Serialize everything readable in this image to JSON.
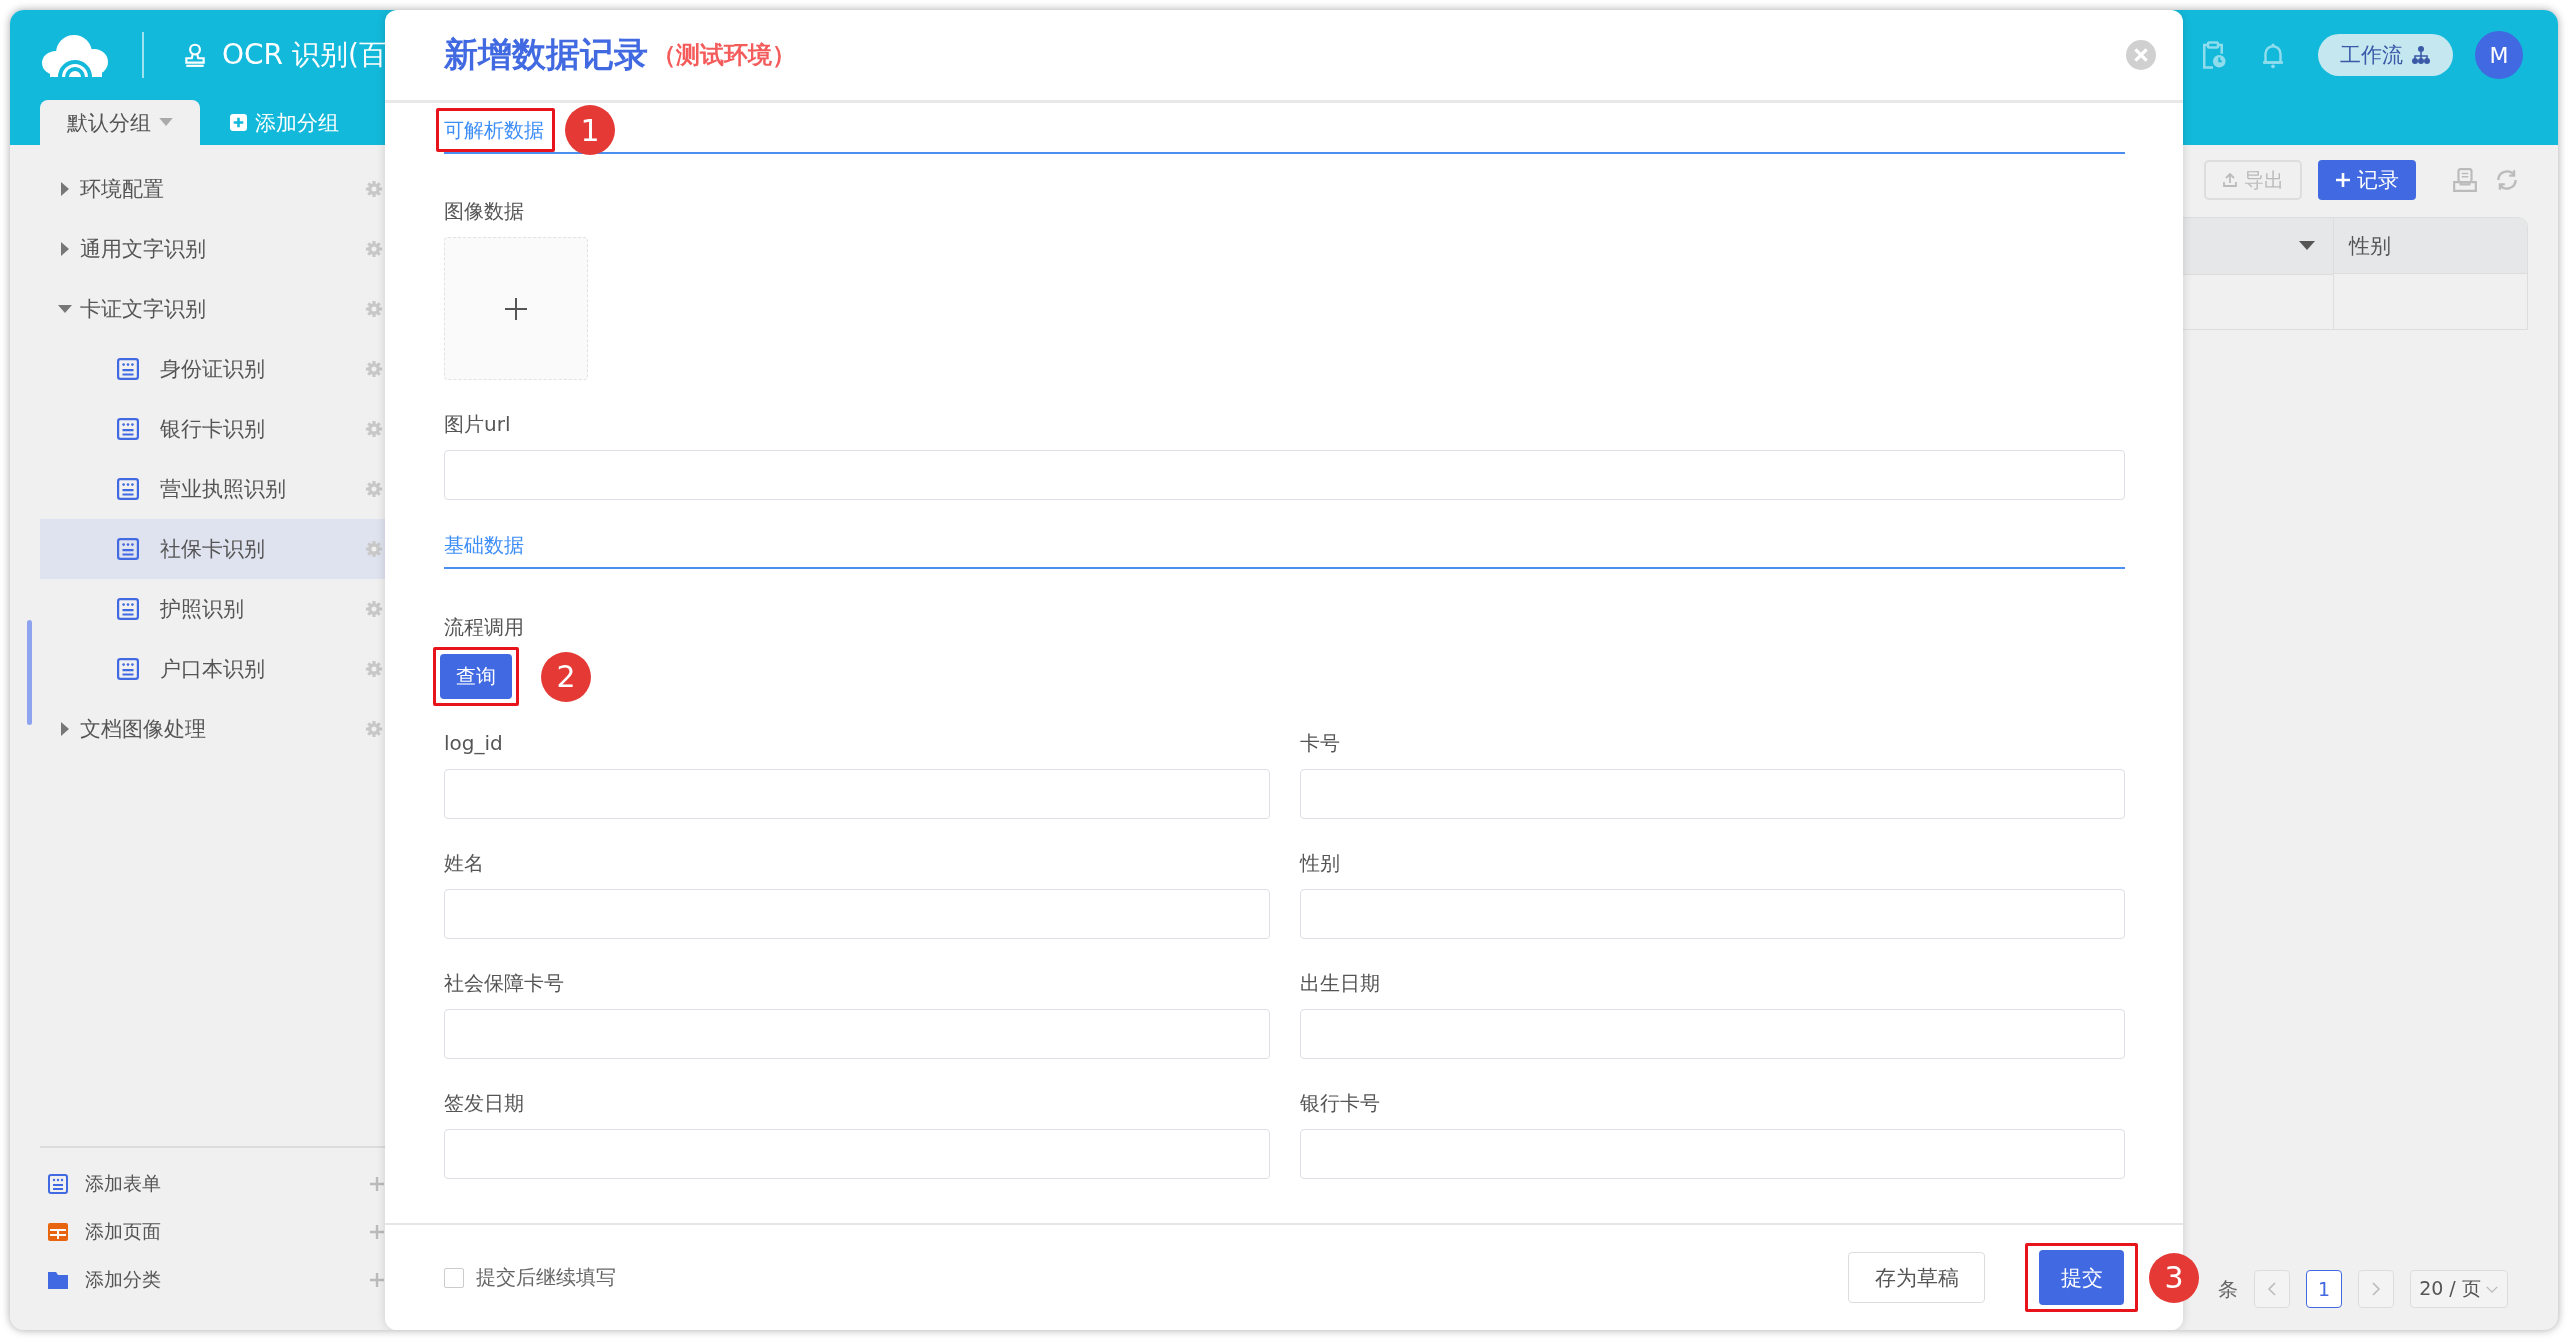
{
  "app": {
    "title": "OCR 识别(百",
    "group_tab": {
      "label": "默认分组",
      "selected": true
    },
    "add_group": "添加分组",
    "workflow_button": "工作流",
    "avatar": "M"
  },
  "sidebar": {
    "tree": [
      {
        "label": "环境配置",
        "expanded": false,
        "selected": false
      },
      {
        "label": "通用文字识别",
        "expanded": false,
        "selected": false
      },
      {
        "label": "卡证文字识别",
        "expanded": true,
        "selected": false,
        "children": [
          {
            "label": "身份证识别",
            "selected": false
          },
          {
            "label": "银行卡识别",
            "selected": false
          },
          {
            "label": "营业执照识别",
            "selected": false
          },
          {
            "label": "社保卡识别",
            "selected": true
          },
          {
            "label": "护照识别",
            "selected": false
          },
          {
            "label": "户口本识别",
            "selected": false
          }
        ]
      },
      {
        "label": "文档图像处理",
        "expanded": false,
        "selected": false
      }
    ],
    "actions": [
      {
        "label": "添加表单",
        "kind": "form"
      },
      {
        "label": "添加页面",
        "kind": "page"
      },
      {
        "label": "添加分类",
        "kind": "folder"
      }
    ]
  },
  "toolbar": {
    "export": "导出",
    "add_record": "记录"
  },
  "table": {
    "columns": [
      "性别"
    ]
  },
  "pagination": {
    "total_suffix": "条",
    "pages": [
      {
        "label": "1",
        "selected": true
      }
    ],
    "page_size": "20 / 页"
  },
  "modal": {
    "title": "新增数据记录",
    "env": "（测试环境）",
    "sections": [
      {
        "title": "可解析数据",
        "step": "1",
        "fields": [
          {
            "label": "图像数据",
            "kind": "upload"
          },
          {
            "label": "图片url",
            "kind": "input"
          }
        ]
      },
      {
        "title": "基础数据",
        "action": {
          "label": "流程调用",
          "button": "查询",
          "step": "2"
        },
        "fields": [
          {
            "label": "log_id",
            "kind": "input"
          },
          {
            "label": "卡号",
            "kind": "input"
          },
          {
            "label": "姓名",
            "kind": "input"
          },
          {
            "label": "性别",
            "kind": "input"
          },
          {
            "label": "社会保障卡号",
            "kind": "input"
          },
          {
            "label": "出生日期",
            "kind": "input"
          },
          {
            "label": "签发日期",
            "kind": "input"
          },
          {
            "label": "银行卡号",
            "kind": "input"
          }
        ]
      }
    ],
    "footer": {
      "continue": {
        "label": "提交后继续填写",
        "checked": false
      },
      "draft": "存为草稿",
      "submit": "提交",
      "step": "3"
    }
  }
}
